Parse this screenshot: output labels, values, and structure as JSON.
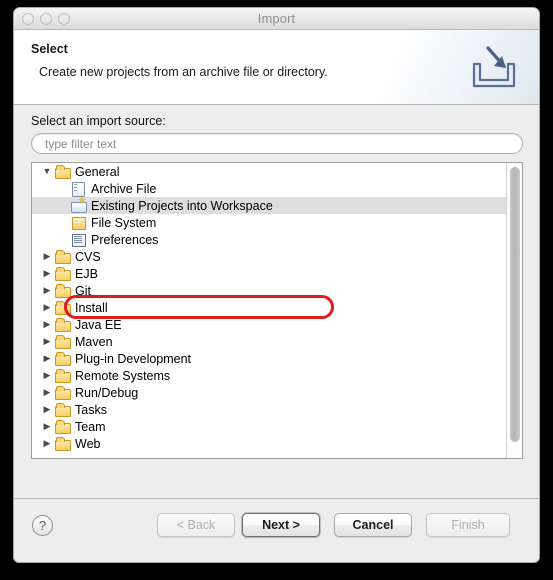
{
  "window": {
    "title": "Import",
    "controls": [
      "close-button",
      "minimize-button",
      "zoom-button"
    ]
  },
  "header": {
    "title": "Select",
    "description": "Create new projects from an archive file or directory.",
    "icon": "import-wizard-icon"
  },
  "body": {
    "source_label": "Select an import source:",
    "filter": {
      "value": "",
      "placeholder": "type filter text"
    }
  },
  "tree": {
    "items": [
      {
        "label": "General",
        "level": 0,
        "expanded": true,
        "icon": "folder-icon",
        "selected": false
      },
      {
        "label": "Archive File",
        "level": 1,
        "expanded": null,
        "icon": "archive-icon",
        "selected": false
      },
      {
        "label": "Existing Projects into Workspace",
        "level": 1,
        "expanded": null,
        "icon": "projects-icon",
        "selected": true
      },
      {
        "label": "File System",
        "level": 1,
        "expanded": null,
        "icon": "filesystem-icon",
        "selected": false
      },
      {
        "label": "Preferences",
        "level": 1,
        "expanded": null,
        "icon": "preferences-icon",
        "selected": false
      },
      {
        "label": "CVS",
        "level": 0,
        "expanded": false,
        "icon": "folder-icon",
        "selected": false
      },
      {
        "label": "EJB",
        "level": 0,
        "expanded": false,
        "icon": "folder-icon",
        "selected": false
      },
      {
        "label": "Git",
        "level": 0,
        "expanded": false,
        "icon": "folder-icon",
        "selected": false
      },
      {
        "label": "Install",
        "level": 0,
        "expanded": false,
        "icon": "folder-icon",
        "selected": false
      },
      {
        "label": "Java EE",
        "level": 0,
        "expanded": false,
        "icon": "folder-icon",
        "selected": false
      },
      {
        "label": "Maven",
        "level": 0,
        "expanded": false,
        "icon": "folder-icon",
        "selected": false
      },
      {
        "label": "Plug-in Development",
        "level": 0,
        "expanded": false,
        "icon": "folder-icon",
        "selected": false
      },
      {
        "label": "Remote Systems",
        "level": 0,
        "expanded": false,
        "icon": "folder-icon",
        "selected": false
      },
      {
        "label": "Run/Debug",
        "level": 0,
        "expanded": false,
        "icon": "folder-icon",
        "selected": false
      },
      {
        "label": "Tasks",
        "level": 0,
        "expanded": false,
        "icon": "folder-icon",
        "selected": false
      },
      {
        "label": "Team",
        "level": 0,
        "expanded": false,
        "icon": "folder-icon",
        "selected": false
      },
      {
        "label": "Web",
        "level": 0,
        "expanded": false,
        "icon": "folder-icon",
        "selected": false
      }
    ],
    "expanded_glyph": "▼",
    "collapsed_glyph": "▶"
  },
  "annotation": {
    "kind": "red-oval-highlight",
    "color": "#e01b1b",
    "targets": "Existing Projects into Workspace"
  },
  "footer": {
    "help_label": "?",
    "buttons": [
      {
        "id": "back",
        "label": "< Back",
        "enabled": false,
        "default": false
      },
      {
        "id": "next",
        "label": "Next >",
        "enabled": true,
        "default": true
      },
      {
        "id": "cancel",
        "label": "Cancel",
        "enabled": true,
        "default": false
      },
      {
        "id": "finish",
        "label": "Finish",
        "enabled": false,
        "default": false
      }
    ]
  }
}
